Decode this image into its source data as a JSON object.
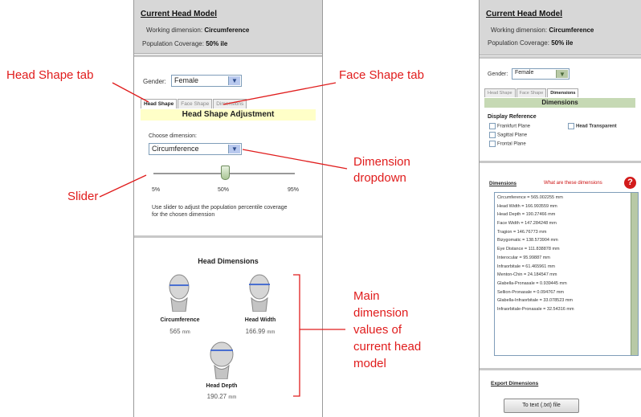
{
  "left": {
    "header": {
      "title": "Current Head Model",
      "working_label": "Working dimension:",
      "working_value": "Circumference",
      "coverage_label": "Population Coverage:",
      "coverage_value": "50% ile"
    },
    "gender": {
      "label": "Gender:",
      "value": "Female"
    },
    "tabs": [
      "Head Shape",
      "Face Shape",
      "Dimensions"
    ],
    "section_title": "Head Shape Adjustment",
    "choose_label": "Choose dimension:",
    "dimension_value": "Circumference",
    "slider": {
      "ticks": [
        "5%",
        "50%",
        "95%"
      ],
      "value_percent": 50
    },
    "hint": "Use slider to adjust the population percentile coverage for the chosen dimension",
    "head_dims_title": "Head Dimensions",
    "dims": [
      {
        "name": "Circumference",
        "value": "565",
        "unit": "mm"
      },
      {
        "name": "Head Width",
        "value": "166.99",
        "unit": "mm"
      },
      {
        "name": "Head Depth",
        "value": "190.27",
        "unit": "mm"
      }
    ]
  },
  "right": {
    "header": {
      "title": "Current Head Model",
      "working_label": "Working dimension:",
      "working_value": "Circumference",
      "coverage_label": "Population Coverage:",
      "coverage_value": "50% ile"
    },
    "gender": {
      "label": "Gender:",
      "value": "Female"
    },
    "tabs": [
      "Head Shape",
      "Face Shape",
      "Dimensions"
    ],
    "section_title": "Dimensions",
    "display_title": "Display Reference",
    "checkboxes": [
      "Frankfurt Plane",
      "Sagittal Plane",
      "Frontal Plane"
    ],
    "transparent_label": "Head Transparent",
    "dims_label": "Dimensions",
    "what_link": "What are these dimensions",
    "help_glyph": "?",
    "list": [
      "Circumference = 565.002255 mm",
      "Head Width = 166.993559 mm",
      "Head Depth = 190.27466 mm",
      "Face Width = 147.284248 mm",
      "Tragion = 146.76773 mm",
      "Bizygomatic = 138.573904 mm",
      "Eye Distance = 111.838878 mm",
      "Interocular = 95.99887 mm",
      "Infraorbitale = 61.465961 mm",
      "Menton-Chin = 24.184547 mm",
      "Glabella-Pronasale = 0.939445 mm",
      "Sellion-Pronasale = 0.094767 mm",
      "Glabella-Infraorbitale = 33.078523 mm",
      "Infraorbitale-Pronasale = 32.54316 mm"
    ],
    "export_title": "Export Dimensions",
    "export_button": "To text (.txt) file"
  },
  "annotations": {
    "head_shape_tab": "Head Shape tab",
    "face_shape_tab": "Face Shape tab",
    "slider": "Slider",
    "dimension_dropdown": [
      "Dimension",
      "dropdown"
    ],
    "main_values": [
      "Main",
      "dimension",
      "values of",
      "current head",
      "model"
    ]
  },
  "colors": {
    "annotation": "#e01c1c",
    "header_bg": "#d7d7d7",
    "title_band": "#ffffc8",
    "scroll": "#b8c9a6"
  }
}
